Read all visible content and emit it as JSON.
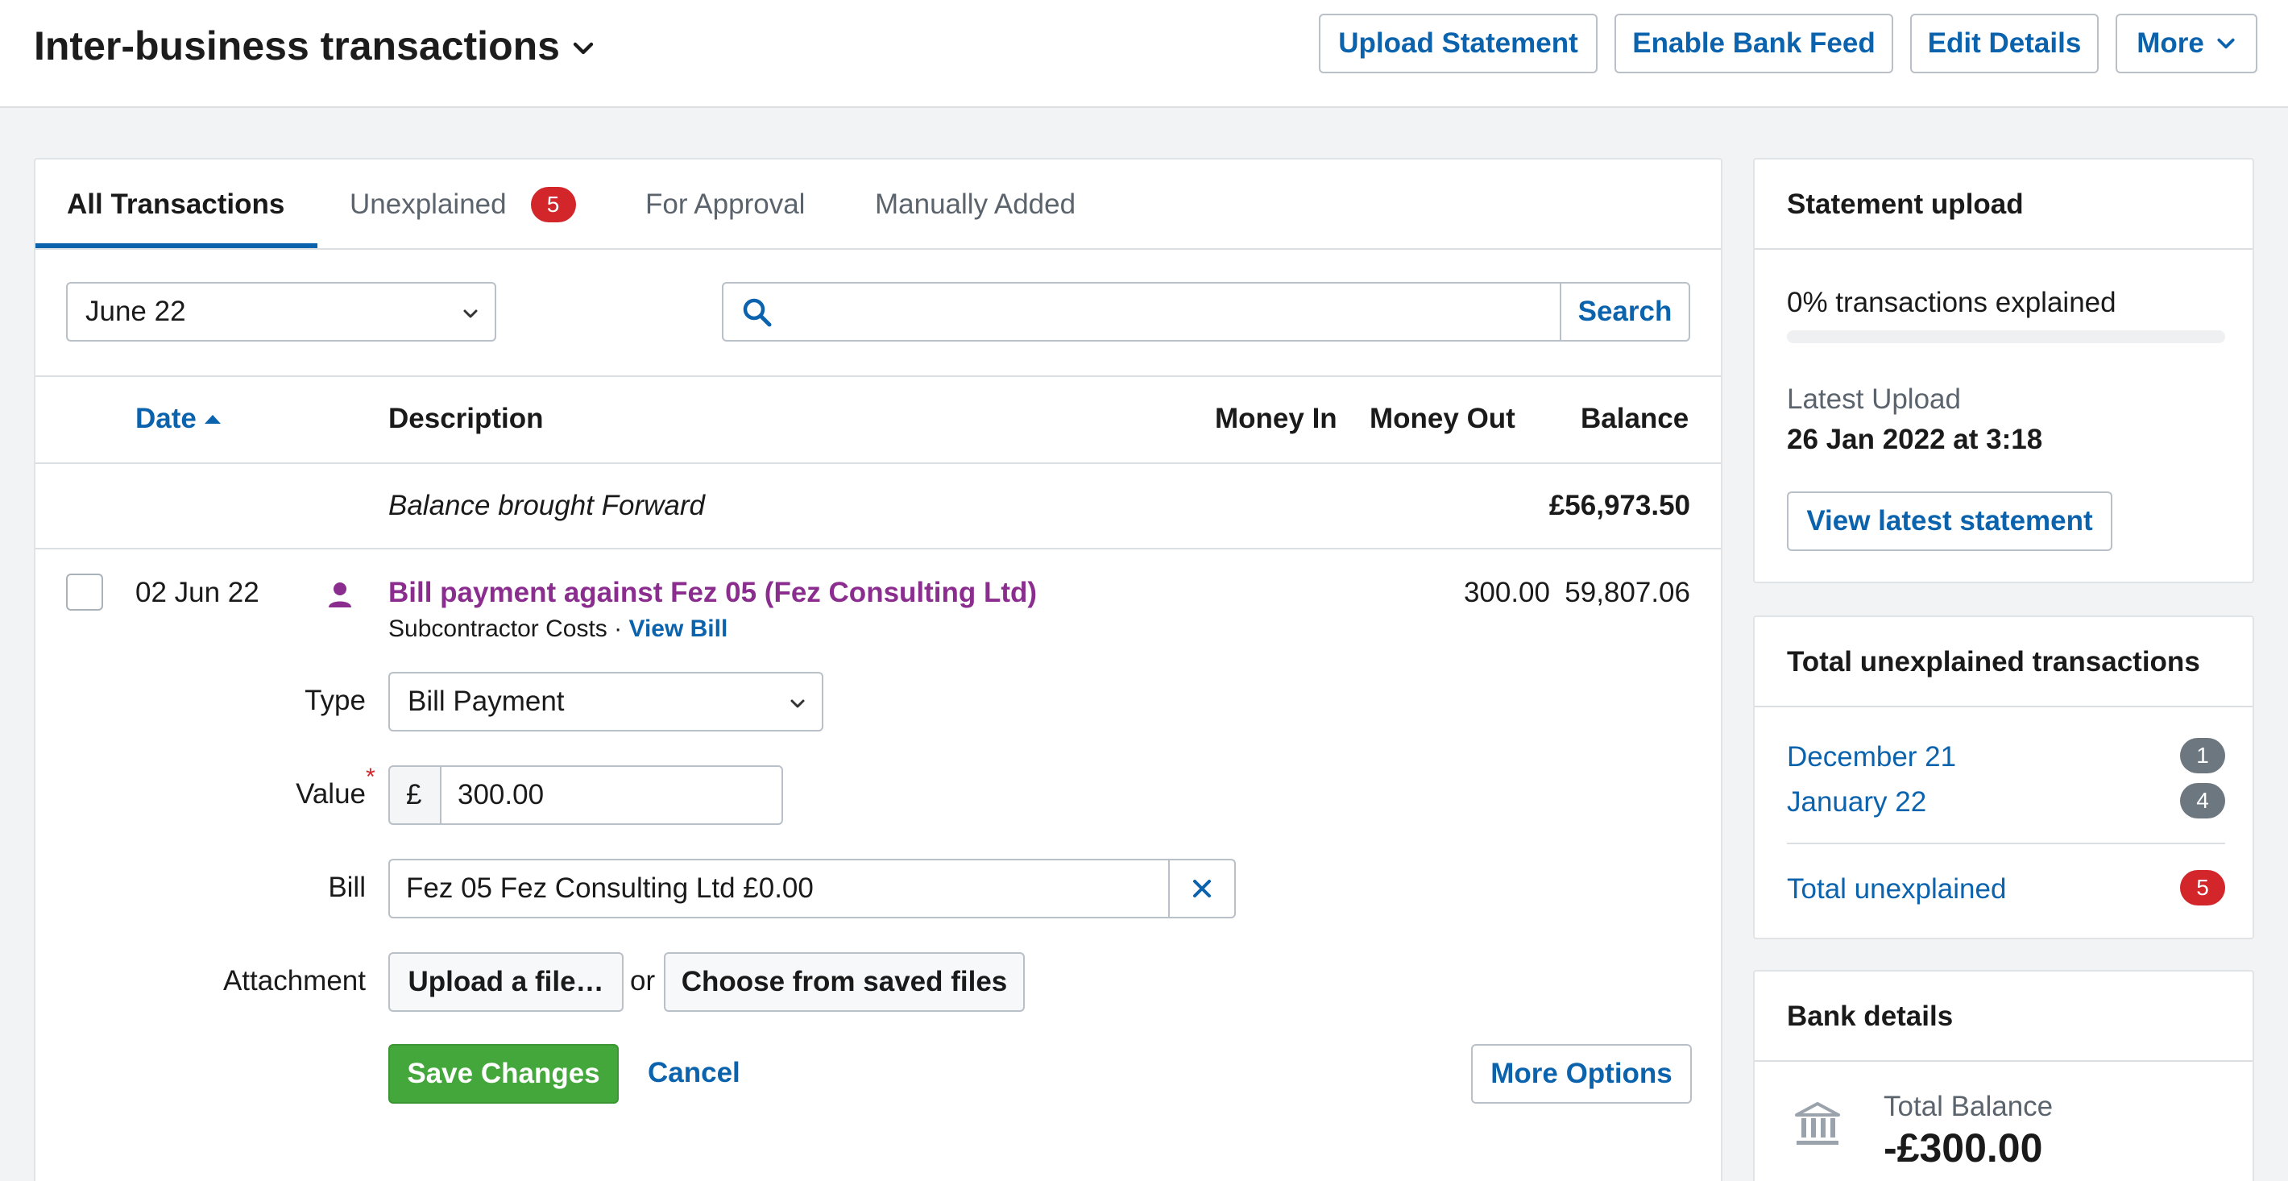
{
  "header": {
    "title": "Inter-business transactions",
    "buttons": {
      "upload_statement": "Upload Statement",
      "enable_bank_feed": "Enable Bank Feed",
      "edit_details": "Edit Details",
      "more": "More"
    }
  },
  "tabs": [
    {
      "label": "All Transactions",
      "active": true
    },
    {
      "label": "Unexplained",
      "badge": "5"
    },
    {
      "label": "For Approval"
    },
    {
      "label": "Manually Added"
    }
  ],
  "filters": {
    "period": "June 22",
    "search_value": "",
    "search_button": "Search"
  },
  "table": {
    "columns": {
      "date": "Date",
      "description": "Description",
      "money_in": "Money In",
      "money_out": "Money Out",
      "balance": "Balance"
    },
    "brought_forward": {
      "label": "Balance brought Forward",
      "balance": "£56,973.50"
    },
    "row": {
      "date": "02 Jun 22",
      "description": "Bill payment against Fez 05 (Fez Consulting Ltd)",
      "category": "Subcontractor Costs",
      "separator": "·",
      "view_bill": "View Bill",
      "money_out": "300.00",
      "balance": "59,807.06"
    }
  },
  "edit_form": {
    "type_label": "Type",
    "type_value": "Bill Payment",
    "value_label": "Value",
    "required_mark": "*",
    "currency": "£",
    "value": "300.00",
    "bill_label": "Bill",
    "bill_value": "Fez 05 Fez Consulting Ltd £0.00",
    "attachment_label": "Attachment",
    "upload_button": "Upload a file…",
    "or_text": "or",
    "choose_button": "Choose from saved files",
    "save_button": "Save Changes",
    "cancel_link": "Cancel",
    "more_options_button": "More Options"
  },
  "statement_upload": {
    "title": "Statement upload",
    "explained_text": "0% transactions explained",
    "explained_percent": 0,
    "latest_upload_label": "Latest Upload",
    "latest_upload_value": "26 Jan 2022 at 3:18",
    "view_button": "View latest statement"
  },
  "unexplained": {
    "title": "Total unexplained transactions",
    "items": [
      {
        "label": "December 21",
        "count": "1"
      },
      {
        "label": "January 22",
        "count": "4"
      }
    ],
    "total_label": "Total unexplained",
    "total_count": "5"
  },
  "bank_details": {
    "title": "Bank details",
    "total_balance_label": "Total Balance",
    "total_balance_value": "-£300.00"
  },
  "colors": {
    "accent": "#0b63ad",
    "danger": "#d2262b",
    "success": "#44a73b",
    "contact": "#8a2d8f"
  },
  "icons": {
    "title_dropdown": "chevron-down-icon",
    "search": "search-icon",
    "contact": "person-icon",
    "clear": "close-icon",
    "bank": "bank-icon",
    "sort": "sort-up-icon"
  }
}
